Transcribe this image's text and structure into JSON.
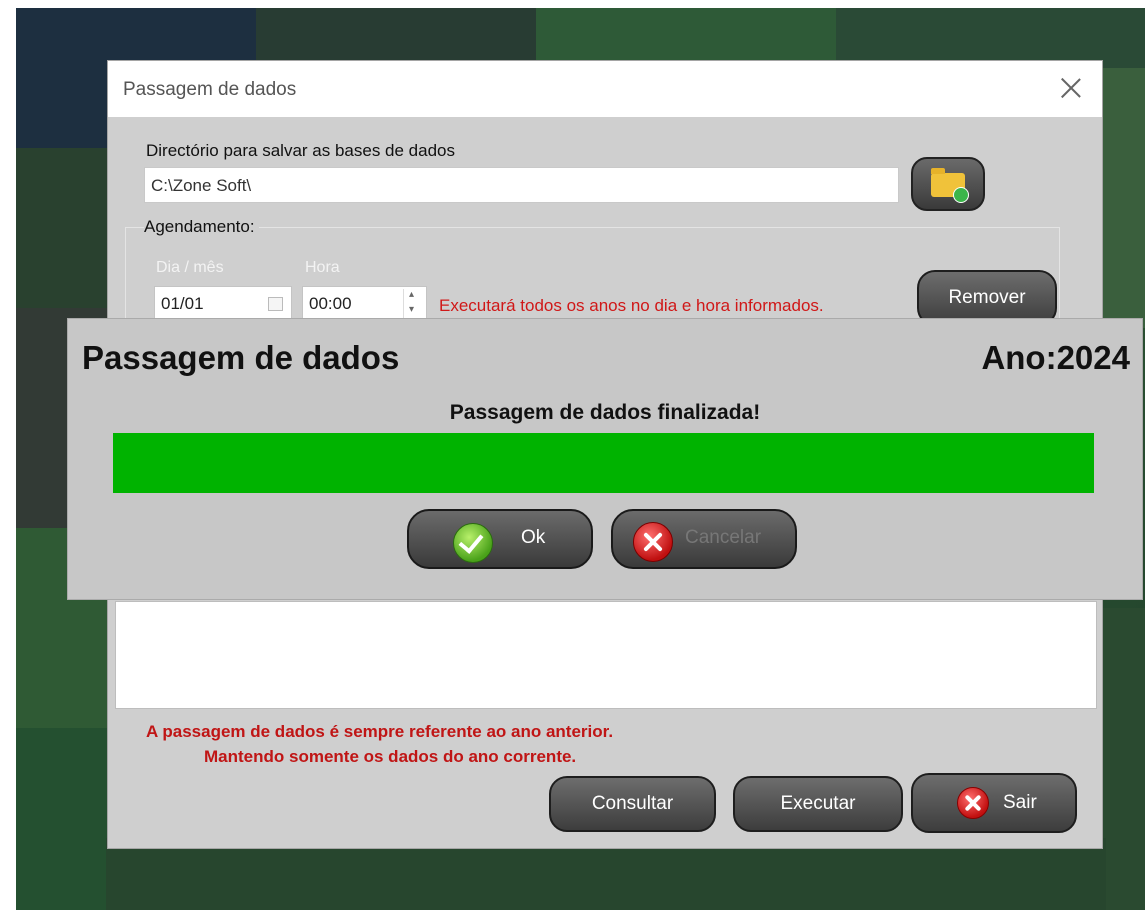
{
  "dialog": {
    "title": "Passagem de dados",
    "directory_label": "Directório para salvar as bases de dados",
    "directory_value": "C:\\Zone Soft\\",
    "schedule_label": "Agendamento:",
    "day_month_label": "Dia / mês",
    "hour_label": "Hora",
    "day_month_value": "01/01",
    "hour_value": "00:00",
    "schedule_hint": "Executará todos os anos no dia e hora informados.",
    "remove_label": "Remover",
    "note_line1": "A passagem de dados é sempre referente ao ano anterior.",
    "note_line2": "Mantendo somente os dados do ano corrente.",
    "consult_label": "Consultar",
    "execute_label": "Executar",
    "exit_label": "Sair"
  },
  "overlay": {
    "title": "Passagem de dados",
    "year_label": "Ano:",
    "year_value": "2024",
    "status": "Passagem de dados finalizada!",
    "progress_percent": 100,
    "ok_label": "Ok",
    "cancel_label": "Cancelar"
  },
  "colors": {
    "progress": "#00b300",
    "warning_text": "#c01515",
    "hint_text": "#d01818"
  },
  "icons": {
    "close": "close-icon",
    "folder": "folder-icon",
    "calendar": "calendar-icon",
    "ok": "check-icon",
    "cancel": "x-circle-icon"
  }
}
